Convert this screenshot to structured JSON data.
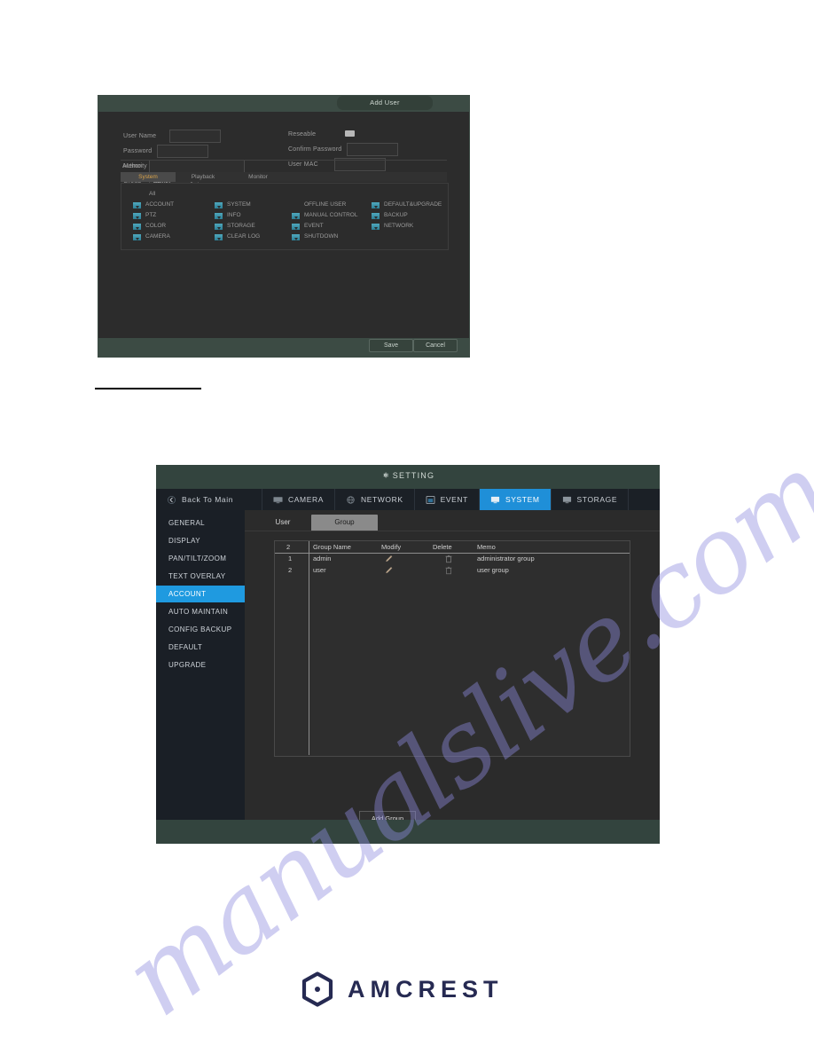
{
  "watermark": {
    "text": "manualslive.com",
    "color": "#8f8ce0"
  },
  "add_user_dialog": {
    "title": "Add User",
    "fields": {
      "user_name_label": "User Name",
      "user_name_value": "",
      "password_label": "Password",
      "password_value": "",
      "memo_label": "Memo",
      "memo_value": "",
      "group_label": "Group",
      "group_value": "admin",
      "reseable_label": "Reseable",
      "reseable_checked": true,
      "confirm_password_label": "Confirm Password",
      "confirm_password_value": "",
      "user_mac_label": "User MAC",
      "user_mac_value": ""
    },
    "authority": {
      "section_label": "Authority",
      "tabs": [
        {
          "label": "System",
          "active": true
        },
        {
          "label": "Playback",
          "active": false
        },
        {
          "label": "Monitor",
          "active": false
        }
      ],
      "all_label": "All",
      "all_checked": false,
      "columns": [
        [
          {
            "label": "ACCOUNT",
            "checked": true
          },
          {
            "label": "PTZ",
            "checked": true
          },
          {
            "label": "COLOR",
            "checked": true
          },
          {
            "label": "CAMERA",
            "checked": true
          }
        ],
        [
          {
            "label": "SYSTEM",
            "checked": true
          },
          {
            "label": "INFO",
            "checked": true
          },
          {
            "label": "STORAGE",
            "checked": true
          },
          {
            "label": "CLEAR LOG",
            "checked": true
          }
        ],
        [
          {
            "label": "OFFLINE USER",
            "checked": false
          },
          {
            "label": "MANUAL CONTROL",
            "checked": true
          },
          {
            "label": "EVENT",
            "checked": true
          },
          {
            "label": "SHUTDOWN",
            "checked": true
          }
        ],
        [
          {
            "label": "DEFAULT&UPGRADE",
            "checked": true
          },
          {
            "label": "BACKUP",
            "checked": true
          },
          {
            "label": "NETWORK",
            "checked": true
          }
        ]
      ]
    },
    "buttons": {
      "save": "Save",
      "cancel": "Cancel"
    }
  },
  "setting_window": {
    "title": "SETTING",
    "nav": {
      "back_label": "Back To Main",
      "items": [
        {
          "label": "CAMERA",
          "icon": "camera-icon",
          "active": false
        },
        {
          "label": "NETWORK",
          "icon": "network-icon",
          "active": false
        },
        {
          "label": "EVENT",
          "icon": "event-icon",
          "active": false
        },
        {
          "label": "SYSTEM",
          "icon": "system-icon",
          "active": true
        },
        {
          "label": "STORAGE",
          "icon": "storage-icon",
          "active": false
        }
      ]
    },
    "sidebar": {
      "items": [
        {
          "label": "GENERAL",
          "active": false
        },
        {
          "label": "DISPLAY",
          "active": false
        },
        {
          "label": "PAN/TILT/ZOOM",
          "active": false
        },
        {
          "label": "TEXT OVERLAY",
          "active": false
        },
        {
          "label": "ACCOUNT",
          "active": true
        },
        {
          "label": "AUTO MAINTAIN",
          "active": false
        },
        {
          "label": "CONFIG BACKUP",
          "active": false
        },
        {
          "label": "DEFAULT",
          "active": false
        },
        {
          "label": "UPGRADE",
          "active": false
        }
      ],
      "accent_color": "#1f9ae0"
    },
    "tabs": [
      {
        "label": "User",
        "selected": false
      },
      {
        "label": "Group",
        "selected": true
      }
    ],
    "table": {
      "headers": [
        "2",
        "Group Name",
        "Modify",
        "Delete",
        "Memo"
      ],
      "rows": [
        {
          "index": "1",
          "group_name": "admin",
          "modify": "pencil-icon",
          "delete": "trash-icon",
          "memo": "administrator group"
        },
        {
          "index": "2",
          "group_name": "user",
          "modify": "pencil-icon",
          "delete": "trash-icon",
          "memo": "user group"
        }
      ]
    },
    "add_group_button": "Add Group"
  },
  "logo": {
    "text": "AMCREST",
    "color": "#262a52"
  }
}
